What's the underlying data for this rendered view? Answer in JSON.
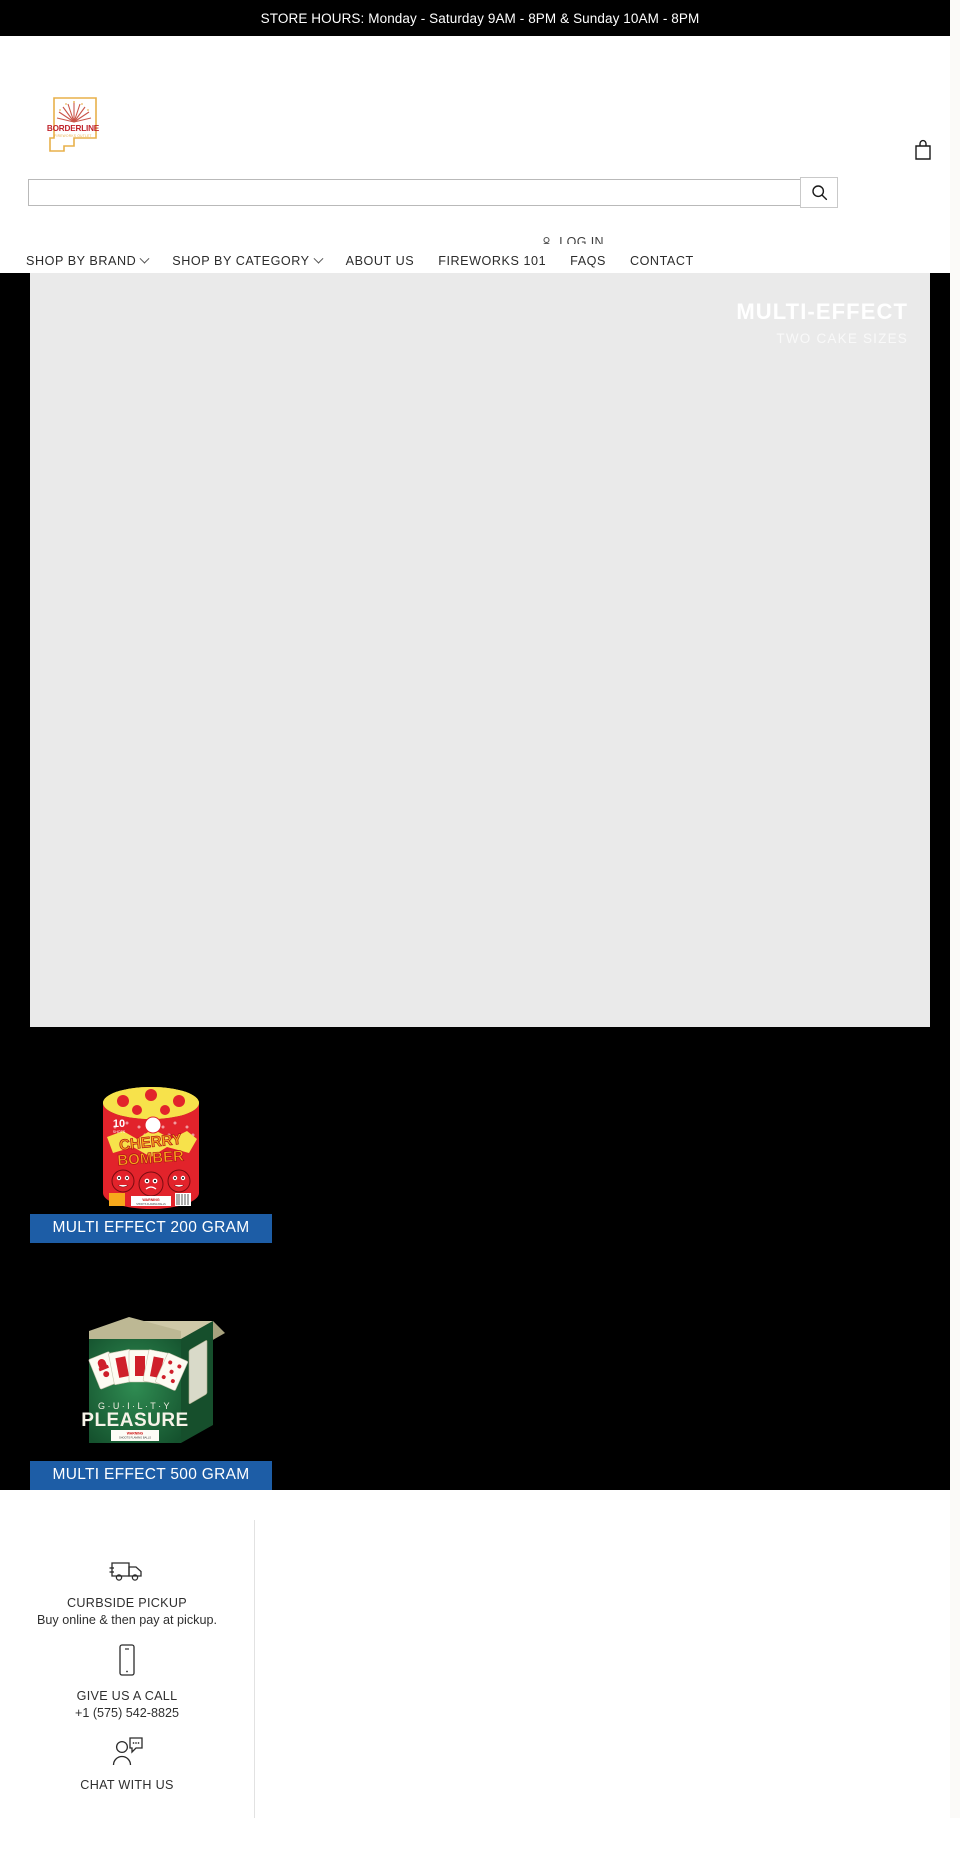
{
  "announcement": {
    "text": "STORE HOURS: Monday - Saturday 9AM - 8PM & Sunday 10AM - 8PM"
  },
  "header": {
    "logo": {
      "name": "borderline-fireworks-outlet-logo",
      "brand": "BORDERLINE",
      "tagline": "FIREWORKS OUTLET"
    },
    "cart": {
      "icon": "shopping-bag-icon",
      "label": "Cart"
    },
    "search": {
      "value": "",
      "placeholder": "",
      "button_icon": "search-icon",
      "button_label": "Search"
    },
    "account": {
      "icon": "user-icon",
      "label": "LOG IN"
    }
  },
  "nav": {
    "items": [
      {
        "label": "SHOP BY BRAND",
        "has_dropdown": true
      },
      {
        "label": "SHOP BY CATEGORY",
        "has_dropdown": true
      },
      {
        "label": "ABOUT US",
        "has_dropdown": false
      },
      {
        "label": "FIREWORKS 101",
        "has_dropdown": false
      },
      {
        "label": "FAQS",
        "has_dropdown": false
      },
      {
        "label": "CONTACT",
        "has_dropdown": false
      }
    ]
  },
  "hero": {
    "title": "MULTI-EFFECT",
    "subtitle": "TWO CAKE SIZES"
  },
  "collections": [
    {
      "caption": "MULTI EFFECT 200 GRAM",
      "product_name": "CHERRY BOMBER",
      "shot_count": "10",
      "shot_label": "SHOTS",
      "warning": "WARNING",
      "image_name": "cherry-bomber-cake-image"
    },
    {
      "caption": "MULTI EFFECT 500 GRAM",
      "product_name": "PLEASURE",
      "product_name_top": "G·U·I·L·T·Y",
      "warning": "WARNING",
      "warning_sub": "SHOOTS FLAMING BALLS",
      "image_name": "guilty-pleasure-cake-image"
    }
  ],
  "footer": {
    "blocks": [
      {
        "icon": "delivery-truck-icon",
        "title": "CURBSIDE PICKUP",
        "subtitle": "Buy online & then pay at pickup."
      },
      {
        "icon": "mobile-phone-icon",
        "title": "GIVE US A CALL",
        "subtitle": "+1 (575) 542-8825"
      },
      {
        "icon": "chat-bubble-person-icon",
        "title": "CHAT WITH US",
        "subtitle": ""
      }
    ]
  },
  "colors": {
    "announcement_bg": "#000000",
    "body_bg": "#000000",
    "hero_bg": "#eaeaea",
    "caption_blue": "#1d5da6",
    "logo_red": "#c0232b",
    "logo_gold": "#e8b04a"
  }
}
